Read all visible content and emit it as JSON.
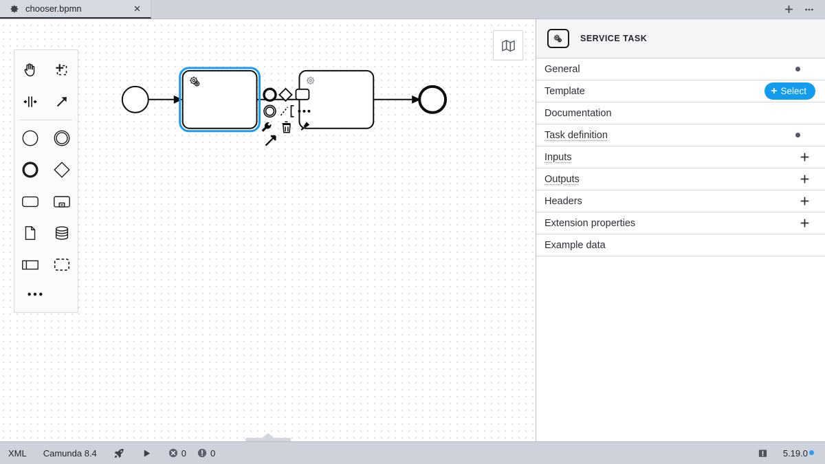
{
  "window": {
    "tabs": [
      {
        "label": "chooser.bpmn",
        "icon": "gear-icon",
        "close_icon": "close-icon",
        "active": true
      }
    ],
    "actions": [
      {
        "name": "new-tab-button",
        "glyph": "+"
      },
      {
        "name": "tab-overflow-button",
        "glyph": "···"
      }
    ]
  },
  "palette": {
    "tools": [
      {
        "name": "hand-tool",
        "icon": "hand-icon"
      },
      {
        "name": "lasso-tool",
        "icon": "lasso-select-icon"
      },
      {
        "name": "space-tool",
        "icon": "space-tool-icon"
      },
      {
        "name": "global-connect-tool",
        "icon": "arrow-up-right-icon"
      }
    ],
    "elements": [
      {
        "name": "create-start-event",
        "icon": "start-event-circle-icon"
      },
      {
        "name": "create-intermediate-event",
        "icon": "intermediate-event-double-circle-icon"
      },
      {
        "name": "create-end-event",
        "icon": "end-event-thick-circle-icon"
      },
      {
        "name": "create-gateway",
        "icon": "gateway-diamond-icon"
      },
      {
        "name": "create-task",
        "icon": "task-rounded-rect-icon"
      },
      {
        "name": "create-subprocess",
        "icon": "subprocess-collapsed-icon"
      },
      {
        "name": "create-data-object",
        "icon": "data-object-page-icon"
      },
      {
        "name": "create-data-store",
        "icon": "data-store-cylinder-icon"
      },
      {
        "name": "create-participant",
        "icon": "participant-pool-icon"
      },
      {
        "name": "create-group",
        "icon": "group-dashed-rect-icon"
      }
    ],
    "more": {
      "name": "palette-more-button",
      "glyph": "•••"
    }
  },
  "canvas": {
    "minimap_toggle": {
      "name": "minimap-toggle-button",
      "icon": "map-icon"
    },
    "bottom_panel_handle": {
      "name": "bottom-panel-handle",
      "icon": "chevron-up-icon"
    },
    "diagram": {
      "type": "bpmn",
      "elements": [
        {
          "id": "start",
          "type": "start-event",
          "shape": "circle",
          "selected": false
        },
        {
          "id": "task-1",
          "type": "service-task",
          "shape": "rounded-rect",
          "icon": "gears-icon",
          "selected": true
        },
        {
          "id": "task-2",
          "type": "service-task",
          "shape": "rounded-rect",
          "icon": "gears-icon",
          "selected": false
        },
        {
          "id": "end",
          "type": "end-event",
          "shape": "thick-circle",
          "selected": false
        }
      ],
      "flows": [
        {
          "from": "start",
          "to": "task-1"
        },
        {
          "from": "task-1",
          "to": "task-2"
        },
        {
          "from": "task-2",
          "to": "end"
        }
      ]
    },
    "context_pad": {
      "name": "context-pad",
      "entries": [
        {
          "name": "append-end-event",
          "icon": "end-event-thick-circle-icon"
        },
        {
          "name": "append-gateway",
          "icon": "gateway-diamond-icon"
        },
        {
          "name": "append-task",
          "icon": "task-rounded-rect-icon"
        },
        {
          "name": "append-intermediate-event",
          "icon": "intermediate-event-double-circle-icon"
        },
        {
          "name": "append-text-annotation",
          "icon": "text-annotation-icon"
        },
        {
          "name": "more-options",
          "icon": "ellipsis-icon"
        },
        {
          "name": "replace-element",
          "icon": "wrench-icon"
        },
        {
          "name": "delete-element",
          "icon": "trash-icon"
        },
        {
          "name": "set-color",
          "icon": "paintbrush-icon"
        },
        {
          "name": "connect",
          "icon": "arrow-up-right-icon"
        }
      ]
    }
  },
  "properties_panel": {
    "header": {
      "title": "SERVICE TASK",
      "icon": "service-task-icon"
    },
    "groups": [
      {
        "label": "General",
        "control": "chevron",
        "marker": true,
        "hinted": false
      },
      {
        "label": "Template",
        "control": "select",
        "marker": false,
        "hinted": false,
        "button_label": "Select",
        "button_glyph": "+"
      },
      {
        "label": "Documentation",
        "control": "chevron",
        "marker": false,
        "hinted": false
      },
      {
        "label": "Task definition",
        "control": "chevron",
        "marker": true,
        "hinted": true
      },
      {
        "label": "Inputs",
        "control": "plus",
        "marker": false,
        "hinted": true
      },
      {
        "label": "Outputs",
        "control": "plus",
        "marker": false,
        "hinted": true
      },
      {
        "label": "Headers",
        "control": "plus",
        "marker": false,
        "hinted": false
      },
      {
        "label": "Extension properties",
        "control": "plus",
        "marker": false,
        "hinted": false
      },
      {
        "label": "Example data",
        "control": "chevron",
        "marker": false,
        "hinted": false
      }
    ]
  },
  "statusbar": {
    "xml_label": "XML",
    "engine_label": "Camunda 8.4",
    "deploy": {
      "name": "deploy-button",
      "icon": "rocket-icon"
    },
    "run": {
      "name": "run-button",
      "icon": "play-icon"
    },
    "errors": {
      "icon": "error-icon",
      "count": "0"
    },
    "warnings": {
      "icon": "warning-icon",
      "count": "0"
    },
    "notifications": {
      "name": "notifications-button",
      "icon": "notification-icon"
    },
    "version": "5.19.0",
    "update_available": true
  },
  "colors": {
    "accent_blue": "#119cf0",
    "selection_blue": "#1a9bf0",
    "chrome_gray": "#cdd2db",
    "panel_header": "#f4f5f7"
  }
}
